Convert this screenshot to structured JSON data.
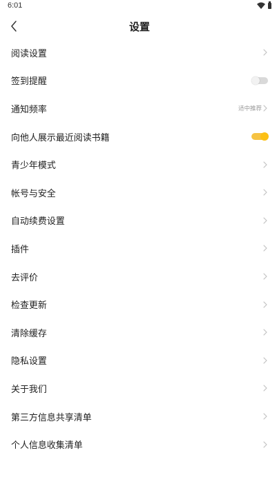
{
  "status_bar": {
    "time": "6:01",
    "icons": [
      "wifi-icon",
      "battery-icon"
    ]
  },
  "header": {
    "title": "设置",
    "back_icon": "chevron-left-icon"
  },
  "colors": {
    "toggle_on": "#fcc015",
    "toggle_off": "#d9d9d9",
    "secondary_text": "#999999"
  },
  "settings": {
    "items": [
      {
        "label": "阅读设置",
        "control": "chevron"
      },
      {
        "label": "签到提醒",
        "control": "toggle",
        "on": false
      },
      {
        "label": "通知频率",
        "value": "适中推荐",
        "control": "chevron"
      },
      {
        "label": "向他人展示最近阅读书籍",
        "control": "toggle",
        "on": true
      },
      {
        "label": "青少年模式",
        "control": "chevron"
      },
      {
        "label": "帐号与安全",
        "control": "chevron"
      },
      {
        "label": "自动续费设置",
        "control": "chevron"
      },
      {
        "label": "插件",
        "control": "chevron"
      },
      {
        "label": "去评价",
        "control": "chevron"
      },
      {
        "label": "检查更新",
        "control": "chevron"
      },
      {
        "label": "清除缓存",
        "control": "chevron"
      },
      {
        "label": "隐私设置",
        "control": "chevron"
      },
      {
        "label": "关于我们",
        "control": "chevron"
      },
      {
        "label": "第三方信息共享清单",
        "control": "chevron"
      },
      {
        "label": "个人信息收集清单",
        "control": "chevron"
      }
    ]
  }
}
